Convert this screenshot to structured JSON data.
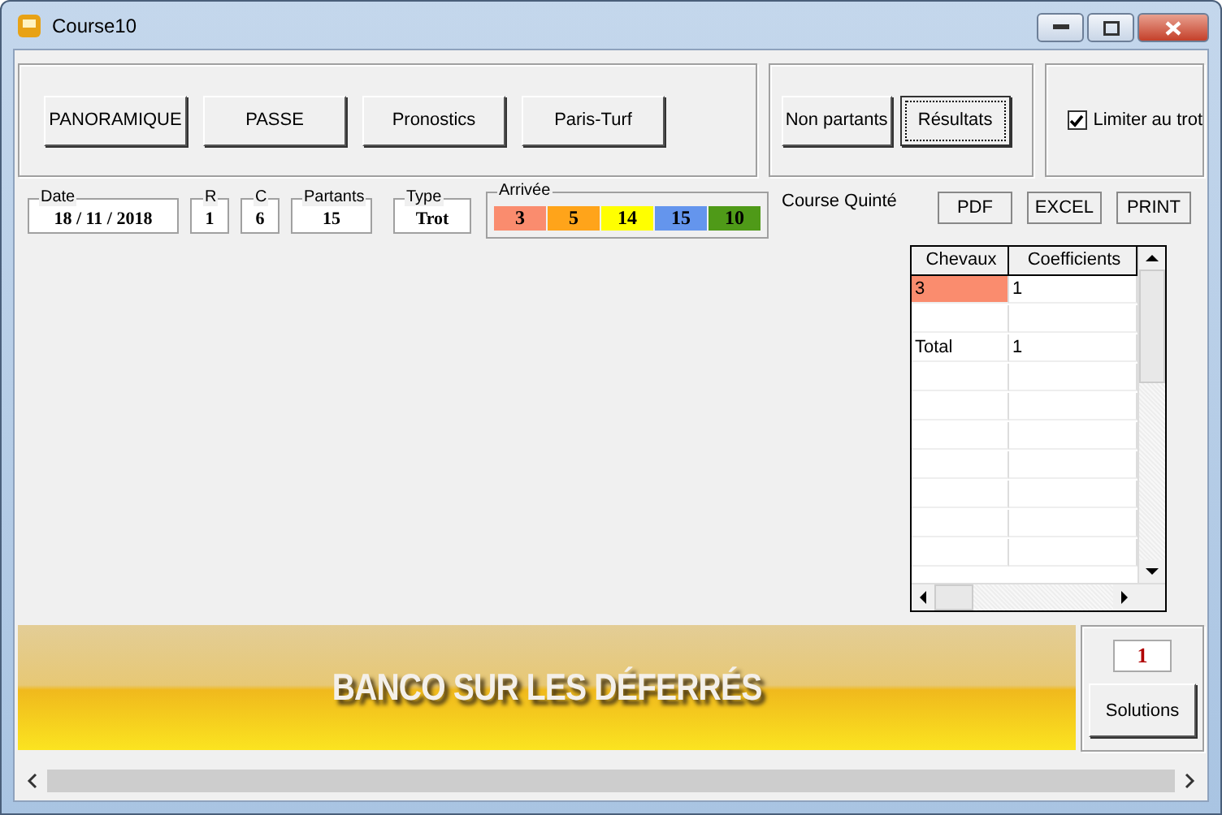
{
  "window": {
    "title": "Course10"
  },
  "nav_buttons": [
    "PANORAMIQUE",
    "PASSE",
    "Pronostics",
    "Paris-Turf"
  ],
  "side_buttons": [
    {
      "label": "Non partants",
      "focused": false
    },
    {
      "label": "Résultats",
      "focused": true
    }
  ],
  "limit_checkbox": {
    "label": "Limiter au trot",
    "checked": true
  },
  "fields": [
    {
      "label": "Date",
      "value": "18 / 11 / 2018"
    },
    {
      "label": "R",
      "value": "1"
    },
    {
      "label": "C",
      "value": "6"
    },
    {
      "label": "Partants",
      "value": "15"
    },
    {
      "label": "Type",
      "value": "Trot"
    }
  ],
  "arrivee": {
    "label": "Arrivée",
    "items": [
      {
        "value": "3",
        "color": "#fa8c6e"
      },
      {
        "value": "5",
        "color": "#ffa41a"
      },
      {
        "value": "14",
        "color": "#ffff00"
      },
      {
        "value": "15",
        "color": "#6495ed"
      },
      {
        "value": "10",
        "color": "#4f9a18"
      }
    ]
  },
  "race_label": "Course Quinté",
  "export_buttons": [
    "PDF",
    "EXCEL",
    "PRINT"
  ],
  "table": {
    "columns": [
      "Chevaux",
      "Coefficients"
    ],
    "rows": [
      {
        "kind": "entry",
        "cells": [
          "3",
          "1"
        ],
        "color": "#fa8c6e"
      },
      {
        "kind": "spacer"
      },
      {
        "kind": "total",
        "cells": [
          "Total",
          "1"
        ]
      }
    ]
  },
  "banner": {
    "text": "BANCO SUR LES DÉFERRÉS"
  },
  "solutions": {
    "count": "1",
    "button": "Solutions"
  }
}
